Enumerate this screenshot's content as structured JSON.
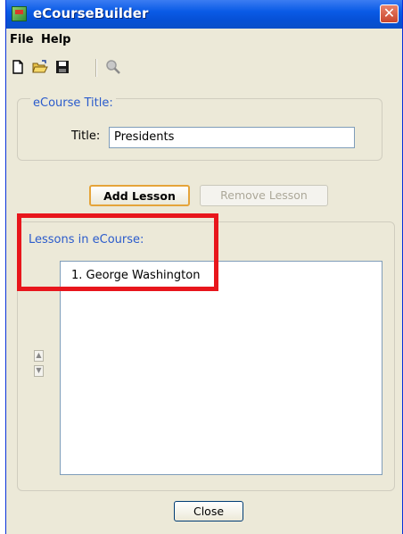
{
  "window": {
    "title": "eCourseBuilder",
    "close_glyph": "✕"
  },
  "menu": {
    "items": [
      {
        "label": "File"
      },
      {
        "label": "Help"
      }
    ]
  },
  "toolbar": {
    "icons": [
      "new-document-icon",
      "open-folder-icon",
      "save-disk-icon",
      "magnifier-icon"
    ]
  },
  "course_title_group": {
    "legend": "eCourse Title:",
    "field_label": "Title:",
    "field_value": "Presidents"
  },
  "buttons": {
    "add_lesson": "Add Lesson",
    "remove_lesson": "Remove Lesson",
    "close": "Close"
  },
  "lessons_group": {
    "legend": "Lessons in eCourse:",
    "items": [
      {
        "label": "1. George Washington"
      }
    ],
    "move_up_glyph": "▲",
    "move_down_glyph": "▼"
  },
  "colors": {
    "title_bar": "#0a5be6",
    "group_legend": "#2a5bcc",
    "highlight": "#e8161c",
    "default_button_border": "#e5a43a"
  }
}
